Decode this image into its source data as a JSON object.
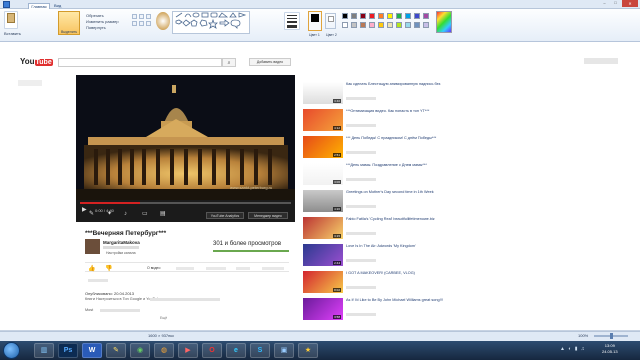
{
  "paint": {
    "tabs": [
      "Главная",
      "Вид"
    ],
    "clipboard": {
      "paste": "Вставить"
    },
    "image_group": {
      "crop": "Обрезать",
      "resize": "Изменить размер",
      "rotate": "Повернуть",
      "select": "Выделить"
    },
    "size_label": "Толщина",
    "color1_label": "Цвет 1",
    "color2_label": "Цвет 2",
    "palette": [
      "#000000",
      "#7f7f7f",
      "#880015",
      "#ed1c24",
      "#ff7f27",
      "#fff200",
      "#22b14c",
      "#00a2e8",
      "#3f48cc",
      "#a349a4",
      "#ffffff",
      "#c3c3c3",
      "#b97a57",
      "#ffaec9",
      "#ffc90e",
      "#efe4b0",
      "#b5e61d",
      "#99d9ea",
      "#7092be",
      "#c8bfe7"
    ],
    "status_size": "1600 × 937пкс",
    "zoom": "100%"
  },
  "youtube": {
    "logo_you": "You",
    "logo_tube": "Tube",
    "upload_label": "Добавить видео",
    "video_watermark": "www.sankt-peterburg.ru",
    "time": "0:00 / 4:40",
    "analytics_btn": "YouTube Analytics",
    "manager_btn": "Менеджер видео",
    "title": "***Вечерняя Петербург***",
    "channel": "MargaritaMakova",
    "channel_settings": "Настройки канала",
    "views": "301 и более просмотров",
    "tab_about": "О видео",
    "published": "Опубликовано: 20.04.2013",
    "desc1": "Книги Настроиться в Ton Google и YouTube",
    "desc2": "Most",
    "show_more": "Ещё"
  },
  "related": [
    {
      "title": "Как сделать Блестящую анимированную надпись без",
      "dur": "3:40"
    },
    {
      "title": "***Оптимизация видео. Как попасть в топ YT***",
      "dur": "4:12"
    },
    {
      "title": "*** День Победы! С праздником! С днём Победы***",
      "dur": "2:51"
    },
    {
      "title": "***День мамы. Поздравление с Днем мамы***",
      "dur": "3:06"
    },
    {
      "title": "Greetings on Mother's Day second time in 1th Week",
      "dur": "4:20"
    },
    {
      "title": "Fabio Fatila's 'Cycling Real' beautifullifetimenowe.biz",
      "dur": "3:15"
    },
    {
      "title": "Love Is In The Air: Adwords 'My Kingdom'",
      "dur": "2:44"
    },
    {
      "title": "I GOT A MAKEOVER! (CARBEE, VLOG)",
      "dur": "8:02"
    },
    {
      "title": "As If I'd Like to Be By John Michael Williams great song!!!",
      "dur": "3:58"
    }
  ],
  "taskbar": {
    "clock_time": "13:09",
    "clock_date": "24.05.13"
  }
}
